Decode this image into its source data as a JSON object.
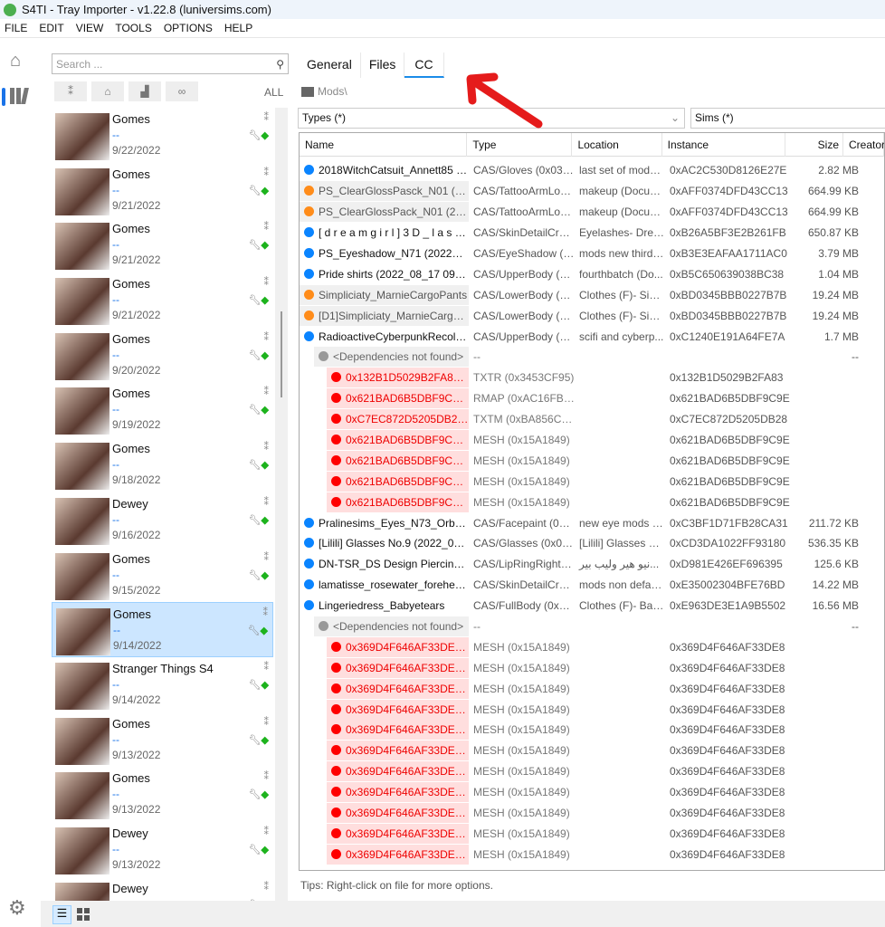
{
  "window": {
    "title": "S4TI - Tray Importer - v1.22.8  (luniversims.com)"
  },
  "menu": [
    "FILE",
    "EDIT",
    "VIEW",
    "TOOLS",
    "OPTIONS",
    "HELP"
  ],
  "search": {
    "placeholder": "Search ..."
  },
  "filters": {
    "all_label": "ALL"
  },
  "sims": [
    {
      "name": "Gomes",
      "creator": "--",
      "date": "9/22/2022"
    },
    {
      "name": "Gomes",
      "creator": "--",
      "date": "9/21/2022"
    },
    {
      "name": "Gomes",
      "creator": "--",
      "date": "9/21/2022"
    },
    {
      "name": "Gomes",
      "creator": "--",
      "date": "9/21/2022"
    },
    {
      "name": "Gomes",
      "creator": "--",
      "date": "9/20/2022"
    },
    {
      "name": "Gomes",
      "creator": "--",
      "date": "9/19/2022"
    },
    {
      "name": "Gomes",
      "creator": "--",
      "date": "9/18/2022"
    },
    {
      "name": "Dewey",
      "creator": "--",
      "date": "9/16/2022"
    },
    {
      "name": "Gomes",
      "creator": "--",
      "date": "9/15/2022"
    },
    {
      "name": "Gomes",
      "creator": "--",
      "date": "9/14/2022",
      "selected": true
    },
    {
      "name": "Stranger Things S4",
      "creator": "--",
      "date": "9/14/2022"
    },
    {
      "name": "Gomes",
      "creator": "--",
      "date": "9/13/2022"
    },
    {
      "name": "Gomes",
      "creator": "--",
      "date": "9/13/2022"
    },
    {
      "name": "Dewey",
      "creator": "--",
      "date": "9/13/2022"
    },
    {
      "name": "Dewey",
      "creator": "--",
      "date": ""
    }
  ],
  "tabs": [
    {
      "label": "General"
    },
    {
      "label": "Files"
    },
    {
      "label": "CC",
      "active": true
    }
  ],
  "breadcrumb": "Mods\\",
  "type_filter": "Types (*)",
  "sims_filter": "Sims (*)",
  "columns": [
    "Name",
    "Type",
    "Location",
    "Instance",
    "Size",
    "Creator"
  ],
  "colors": {
    "blue": "#0a84ff",
    "orange": "#ff8c1a",
    "gray": "#999999",
    "red": "#ff0000"
  },
  "rows": [
    {
      "kind": "file",
      "status": "blue",
      "name": "2018WitchCatsuit_Annett85 (20...",
      "type": "CAS/Gloves (0x034...",
      "location": "last set of mods f...",
      "instance": "0xAC2C530D8126E27E",
      "size": "2.82 MB"
    },
    {
      "kind": "orange",
      "status": "orange",
      "name": "PS_ClearGlossPasck_N01 (202...",
      "type": "CAS/TattooArmLow...",
      "location": "makeup (Docum...",
      "instance": "0xAFF0374DFD43CC13",
      "size": "664.99 KB"
    },
    {
      "kind": "orange",
      "status": "orange",
      "name": "PS_ClearGlossPack_N01 (2022...",
      "type": "CAS/TattooArmLow...",
      "location": "makeup (Docum...",
      "instance": "0xAFF0374DFD43CC13",
      "size": "664.99 KB"
    },
    {
      "kind": "file",
      "status": "blue",
      "name": "[ d r e a m g i r l ] 3 D _ l a s h e s...",
      "type": "CAS/SkinDetailCrea...",
      "location": "Eyelashes- Drea...",
      "instance": "0xB26A5BF3E2B261FB",
      "size": "650.87 KB"
    },
    {
      "kind": "file",
      "status": "blue",
      "name": "PS_Eyeshadow_N71 (2022_08...",
      "type": "CAS/EyeShadow (0...",
      "location": "mods new third f...",
      "instance": "0xB3E3EAFAA1711AC0",
      "size": "3.79 MB"
    },
    {
      "kind": "file",
      "status": "blue",
      "name": "Pride shirts (2022_08_17 09_31...",
      "type": "CAS/UpperBody (0x...",
      "location": "fourthbatch (Do...",
      "instance": "0xB5C650639038BC38",
      "size": "1.04 MB"
    },
    {
      "kind": "orange",
      "status": "orange",
      "name": "Simpliciaty_MarnieCargoPants",
      "type": "CAS/LowerBody (0x...",
      "location": "Clothes (F)- Simp...",
      "instance": "0xBD0345BBB0227B7B",
      "size": "19.24 MB"
    },
    {
      "kind": "orange",
      "status": "orange",
      "name": "[D1]Simpliciaty_MarnieCargoPa...",
      "type": "CAS/LowerBody (0x...",
      "location": "Clothes (F)- Simp...",
      "instance": "0xBD0345BBB0227B7B",
      "size": "19.24 MB"
    },
    {
      "kind": "file",
      "status": "blue",
      "name": "RadioactiveCyberpunkRecolors...",
      "type": "CAS/UpperBody (0x...",
      "location": "scifi and cyberp...",
      "instance": "0xC1240E191A64FE7A",
      "size": "1.7 MB"
    },
    {
      "kind": "dep",
      "status": "gray",
      "name": "<Dependencies not found>",
      "type": "--",
      "location": "",
      "instance": "",
      "size": "--"
    },
    {
      "kind": "miss",
      "status": "red",
      "name": "0x132B1D5029B2FA83.0...",
      "type": "TXTR (0x3453CF95)",
      "location": "",
      "instance": "0x132B1D5029B2FA83",
      "size": ""
    },
    {
      "kind": "miss",
      "status": "red",
      "name": "0x621BAD6B5DBF9C9E....",
      "type": "RMAP (0xAC16FBEC)",
      "location": "",
      "instance": "0x621BAD6B5DBF9C9E",
      "size": ""
    },
    {
      "kind": "miss",
      "status": "red",
      "name": "0xC7EC872D5205DB28.0...",
      "type": "TXTM (0xBA856C78)",
      "location": "",
      "instance": "0xC7EC872D5205DB28",
      "size": ""
    },
    {
      "kind": "miss",
      "status": "red",
      "name": "0x621BAD6B5DBF9C9E....",
      "type": "MESH (0x15A1849)",
      "location": "",
      "instance": "0x621BAD6B5DBF9C9E",
      "size": ""
    },
    {
      "kind": "miss",
      "status": "red",
      "name": "0x621BAD6B5DBF9C9E....",
      "type": "MESH (0x15A1849)",
      "location": "",
      "instance": "0x621BAD6B5DBF9C9E",
      "size": ""
    },
    {
      "kind": "miss",
      "status": "red",
      "name": "0x621BAD6B5DBF9C9E....",
      "type": "MESH (0x15A1849)",
      "location": "",
      "instance": "0x621BAD6B5DBF9C9E",
      "size": ""
    },
    {
      "kind": "miss",
      "status": "red",
      "name": "0x621BAD6B5DBF9C9E....",
      "type": "MESH (0x15A1849)",
      "location": "",
      "instance": "0x621BAD6B5DBF9C9E",
      "size": ""
    },
    {
      "kind": "file",
      "status": "blue",
      "name": "Pralinesims_Eyes_N73_Orb (20...",
      "type": "CAS/Facepaint (0x0...",
      "location": "new eye mods d...",
      "instance": "0xC3BF1D71FB28CA31",
      "size": "211.72 KB"
    },
    {
      "kind": "file",
      "status": "blue",
      "name": "[Lilili] Glasses No.9 (2022_08_1...",
      "type": "CAS/Glasses (0x03...",
      "location": "[Lilili] Glasses C...",
      "instance": "0xCD3DA1022FF93180",
      "size": "536.35 KB"
    },
    {
      "kind": "file",
      "status": "blue",
      "name": "DN-TSR_DS Design Piercing (2...",
      "type": "CAS/LipRingRight (...",
      "location": "نيو هير وليب بير...",
      "instance": "0xD981E426EF696395",
      "size": "125.6 KB"
    },
    {
      "kind": "file",
      "status": "blue",
      "name": "lamatisse_rosewater_forehead (...",
      "type": "CAS/SkinDetailCrea...",
      "location": "mods non defaul...",
      "instance": "0xE35002304BFE76BD",
      "size": "14.22 MB"
    },
    {
      "kind": "file",
      "status": "blue",
      "name": "Lingeriedress_Babyetears",
      "type": "CAS/FullBody (0x03...",
      "location": "Clothes (F)- Bab...",
      "instance": "0xE963DE3E1A9B5502",
      "size": "16.56 MB"
    },
    {
      "kind": "dep",
      "status": "gray",
      "name": "<Dependencies not found>",
      "type": "--",
      "location": "",
      "instance": "",
      "size": "--"
    },
    {
      "kind": "miss",
      "status": "red",
      "name": "0x369D4F646AF33DE8.0...",
      "type": "MESH (0x15A1849)",
      "location": "",
      "instance": "0x369D4F646AF33DE8",
      "size": ""
    },
    {
      "kind": "miss",
      "status": "red",
      "name": "0x369D4F646AF33DE8.0...",
      "type": "MESH (0x15A1849)",
      "location": "",
      "instance": "0x369D4F646AF33DE8",
      "size": ""
    },
    {
      "kind": "miss",
      "status": "red",
      "name": "0x369D4F646AF33DE8.0...",
      "type": "MESH (0x15A1849)",
      "location": "",
      "instance": "0x369D4F646AF33DE8",
      "size": ""
    },
    {
      "kind": "miss",
      "status": "red",
      "name": "0x369D4F646AF33DE8.0...",
      "type": "MESH (0x15A1849)",
      "location": "",
      "instance": "0x369D4F646AF33DE8",
      "size": ""
    },
    {
      "kind": "miss",
      "status": "red",
      "name": "0x369D4F646AF33DE8.0...",
      "type": "MESH (0x15A1849)",
      "location": "",
      "instance": "0x369D4F646AF33DE8",
      "size": ""
    },
    {
      "kind": "miss",
      "status": "red",
      "name": "0x369D4F646AF33DE8.0...",
      "type": "MESH (0x15A1849)",
      "location": "",
      "instance": "0x369D4F646AF33DE8",
      "size": ""
    },
    {
      "kind": "miss",
      "status": "red",
      "name": "0x369D4F646AF33DE8.0...",
      "type": "MESH (0x15A1849)",
      "location": "",
      "instance": "0x369D4F646AF33DE8",
      "size": ""
    },
    {
      "kind": "miss",
      "status": "red",
      "name": "0x369D4F646AF33DE8.0...",
      "type": "MESH (0x15A1849)",
      "location": "",
      "instance": "0x369D4F646AF33DE8",
      "size": ""
    },
    {
      "kind": "miss",
      "status": "red",
      "name": "0x369D4F646AF33DE8.0...",
      "type": "MESH (0x15A1849)",
      "location": "",
      "instance": "0x369D4F646AF33DE8",
      "size": ""
    },
    {
      "kind": "miss",
      "status": "red",
      "name": "0x369D4F646AF33DE8.0...",
      "type": "MESH (0x15A1849)",
      "location": "",
      "instance": "0x369D4F646AF33DE8",
      "size": ""
    },
    {
      "kind": "miss",
      "status": "red",
      "name": "0x369D4F646AF33DE8.0...",
      "type": "MESH (0x15A1849)",
      "location": "",
      "instance": "0x369D4F646AF33DE8",
      "size": ""
    }
  ],
  "tips": "Tips:  Right-click on file for more options."
}
